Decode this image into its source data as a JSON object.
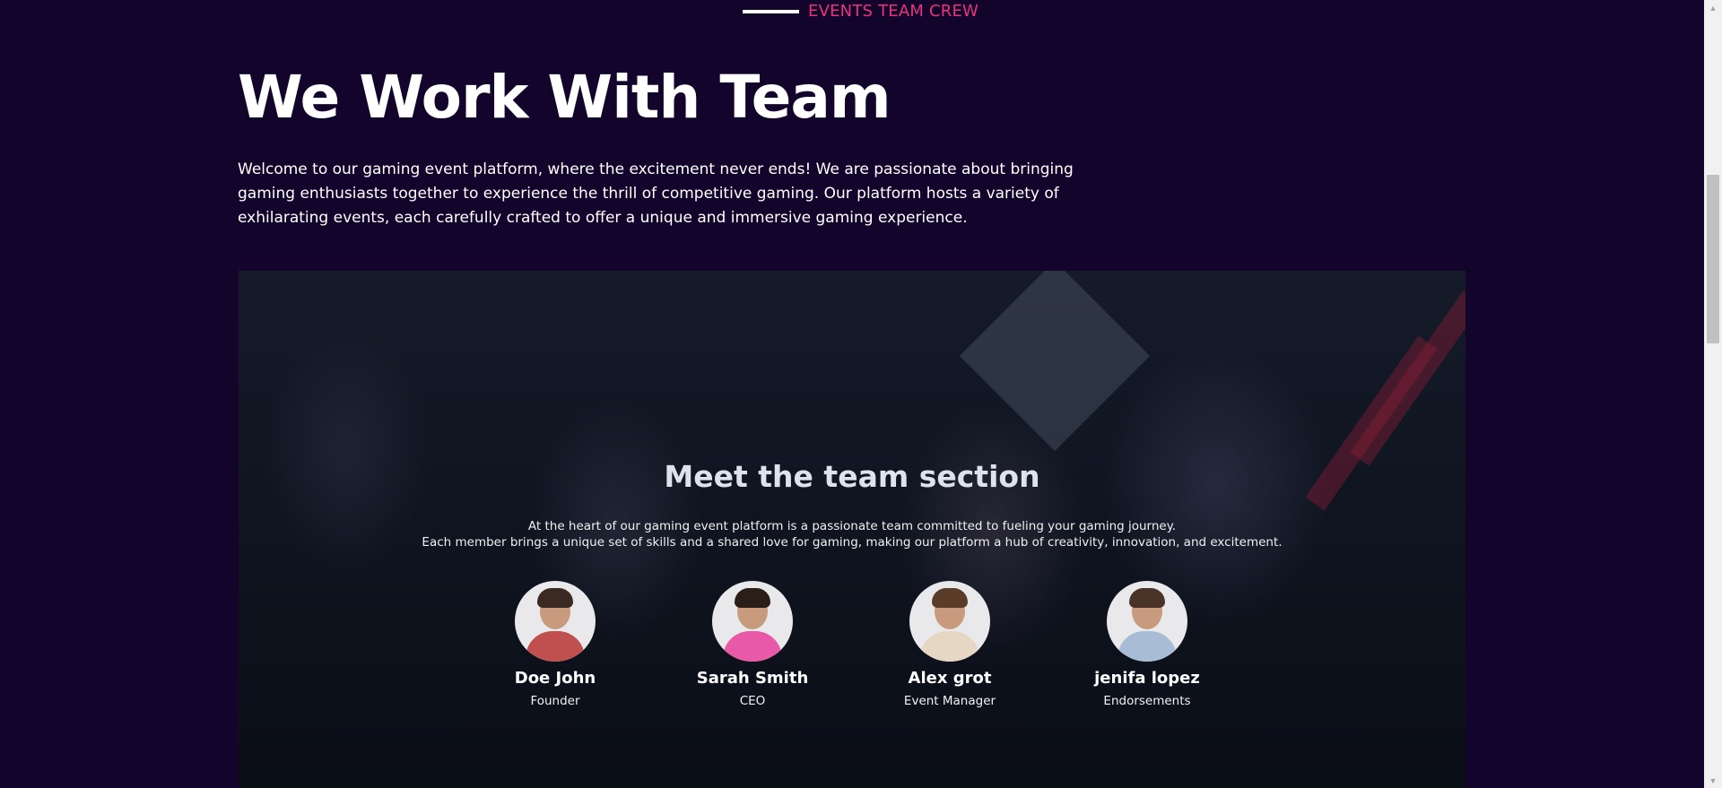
{
  "eyebrow": {
    "text": "EVENTS TEAM CREW"
  },
  "heading": "We Work With Team",
  "intro": "Welcome to our gaming event platform, where the excitement never ends! We are passionate about bringing gaming enthusiasts together to experience the thrill of competitive gaming. Our platform hosts a variety of exhilarating events, each carefully crafted to offer a unique and immersive gaming experience.",
  "team": {
    "title": "Meet the team section",
    "desc_line1": "At the heart of our gaming event platform is a passionate team committed to fueling your gaming journey.",
    "desc_line2": "Each member brings a unique set of skills and a shared love for gaming, making our platform a hub of creativity, innovation, and excitement.",
    "members": [
      {
        "name": "Doe John",
        "role": "Founder",
        "shirt": "#c0504d",
        "hair": "#3a2a22"
      },
      {
        "name": "Sarah Smith",
        "role": "CEO",
        "shirt": "#e85aa8",
        "hair": "#2b1d18"
      },
      {
        "name": "Alex grot",
        "role": "Event Manager",
        "shirt": "#e6d6c4",
        "hair": "#5a3c28"
      },
      {
        "name": "jenifa lopez",
        "role": "Endorsements",
        "shirt": "#a9bcd6",
        "hair": "#4a3428"
      }
    ]
  },
  "colors": {
    "background": "#12042b",
    "accent": "#e8357a"
  }
}
